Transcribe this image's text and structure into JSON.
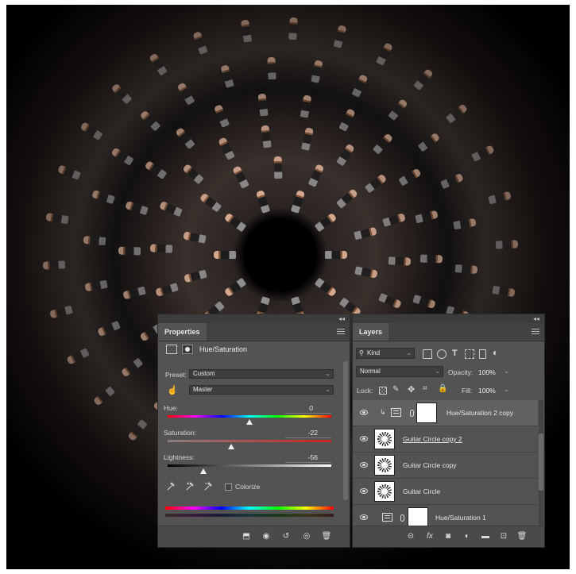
{
  "properties": {
    "tab": "Properties",
    "adjustment_title": "Hue/Saturation",
    "preset_label": "Preset:",
    "preset_value": "Custom",
    "channel_value": "Master",
    "hue_label": "Hue:",
    "hue_value": "0",
    "saturation_label": "Saturation:",
    "saturation_value": "-22",
    "lightness_label": "Lightness:",
    "lightness_value": "-56",
    "colorize_label": "Colorize",
    "colorize_checked": false
  },
  "layers": {
    "tab": "Layers",
    "filter_kind": "Kind",
    "blend_mode": "Normal",
    "opacity_label": "Opacity:",
    "opacity_value": "100%",
    "lock_label": "Lock:",
    "fill_label": "Fill:",
    "fill_value": "100%",
    "items": [
      {
        "name": "Hue/Saturation 2 copy",
        "type": "adjustment",
        "clipped": true,
        "selected": true
      },
      {
        "name": "Guitar Circle copy 2",
        "type": "pixel",
        "underlined": true
      },
      {
        "name": "Guitar Circle copy",
        "type": "pixel"
      },
      {
        "name": "Guitar Circle",
        "type": "pixel"
      },
      {
        "name": "Hue/Saturation 1",
        "type": "adjustment"
      }
    ]
  },
  "colors": {
    "panel_bg": "#535353",
    "selected_row": "#616161",
    "canvas_bg": "#000000"
  }
}
